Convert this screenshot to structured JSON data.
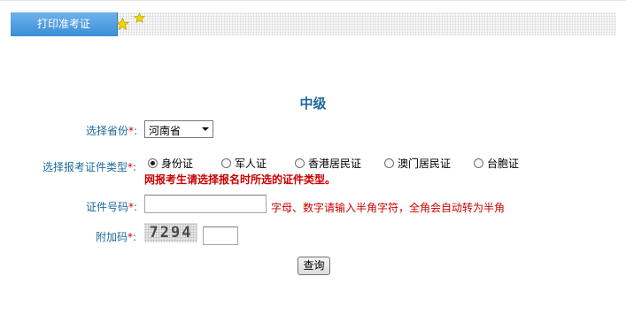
{
  "header": {
    "tab_label": "打印准考证"
  },
  "form": {
    "level_title": "中级",
    "province": {
      "label": "选择省份",
      "required_mark": "*",
      "colon": ":",
      "selected": "河南省"
    },
    "id_type": {
      "label": "选择报考证件类型",
      "required_mark": "*",
      "colon": ":",
      "options": [
        "身份证",
        "军人证",
        "香港居民证",
        "澳门居民证",
        "台胞证"
      ],
      "selected_index": 0,
      "warning": "网报考生请选择报名时所选的证件类型。"
    },
    "id_number": {
      "label": "证件号码",
      "required_mark": "*",
      "colon": ":",
      "value": "",
      "hint": "字母、数字请输入半角字符，全角会自动转为半角"
    },
    "captcha": {
      "label": "附加码",
      "required_mark": "*",
      "colon": ":",
      "image_text": "7294",
      "value": ""
    },
    "submit_label": "查询"
  },
  "icons": {
    "star_color": "#f2d800"
  }
}
